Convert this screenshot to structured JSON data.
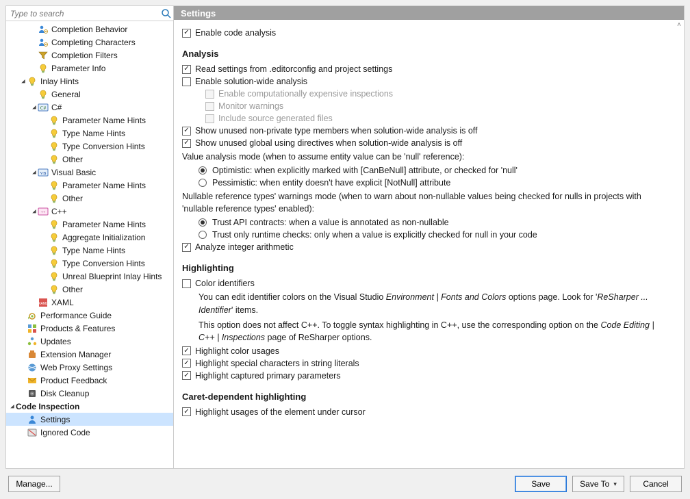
{
  "search": {
    "placeholder": "Type to search"
  },
  "header": {
    "title": "Settings"
  },
  "tree": [
    {
      "depth": 3,
      "icon": "person-gear",
      "label": "Completion Behavior"
    },
    {
      "depth": 3,
      "icon": "person-gear",
      "label": "Completing Characters"
    },
    {
      "depth": 3,
      "icon": "filter",
      "label": "Completion Filters"
    },
    {
      "depth": 3,
      "icon": "bulb",
      "label": "Parameter Info"
    },
    {
      "depth": 2,
      "icon": "bulb",
      "label": "Inlay Hints",
      "expanded": true
    },
    {
      "depth": 3,
      "icon": "bulb",
      "label": "General"
    },
    {
      "depth": 3,
      "icon": "csharp",
      "label": "C#",
      "expanded": true
    },
    {
      "depth": 4,
      "icon": "bulb",
      "label": "Parameter Name Hints"
    },
    {
      "depth": 4,
      "icon": "bulb",
      "label": "Type Name Hints"
    },
    {
      "depth": 4,
      "icon": "bulb",
      "label": "Type Conversion Hints"
    },
    {
      "depth": 4,
      "icon": "bulb",
      "label": "Other"
    },
    {
      "depth": 3,
      "icon": "vb",
      "label": "Visual Basic",
      "expanded": true
    },
    {
      "depth": 4,
      "icon": "bulb",
      "label": "Parameter Name Hints"
    },
    {
      "depth": 4,
      "icon": "bulb",
      "label": "Other"
    },
    {
      "depth": 3,
      "icon": "cpp",
      "label": "C++",
      "expanded": true
    },
    {
      "depth": 4,
      "icon": "bulb",
      "label": "Parameter Name Hints"
    },
    {
      "depth": 4,
      "icon": "bulb",
      "label": "Aggregate Initialization"
    },
    {
      "depth": 4,
      "icon": "bulb",
      "label": "Type Name Hints"
    },
    {
      "depth": 4,
      "icon": "bulb",
      "label": "Type Conversion Hints"
    },
    {
      "depth": 4,
      "icon": "bulb",
      "label": "Unreal Blueprint Inlay Hints"
    },
    {
      "depth": 4,
      "icon": "bulb",
      "label": "Other"
    },
    {
      "depth": 3,
      "icon": "xaml",
      "label": "XAML"
    },
    {
      "depth": 2,
      "icon": "snail",
      "label": "Performance Guide"
    },
    {
      "depth": 2,
      "icon": "grid",
      "label": "Products & Features"
    },
    {
      "depth": 2,
      "icon": "updates",
      "label": "Updates"
    },
    {
      "depth": 2,
      "icon": "ext",
      "label": "Extension Manager"
    },
    {
      "depth": 2,
      "icon": "globe",
      "label": "Web Proxy Settings"
    },
    {
      "depth": 2,
      "icon": "mail",
      "label": "Product Feedback"
    },
    {
      "depth": 2,
      "icon": "disk",
      "label": "Disk Cleanup"
    },
    {
      "depth": 1,
      "icon": "none",
      "label": "Code Inspection",
      "expanded": true,
      "bold": true
    },
    {
      "depth": 2,
      "icon": "person",
      "label": "Settings",
      "selected": true
    },
    {
      "depth": 2,
      "icon": "ignored",
      "label": "Ignored Code"
    }
  ],
  "settings": {
    "enable_code_analysis": "Enable code analysis",
    "analysis_title": "Analysis",
    "read_editorconfig": "Read settings from .editorconfig and project settings",
    "enable_swa": "Enable solution-wide analysis",
    "expensive": "Enable computationally expensive inspections",
    "monitor_warnings": "Monitor warnings",
    "include_sourcegen": "Include source generated files",
    "show_unused_members": "Show unused non-private type members when solution-wide analysis is off",
    "show_unused_usings": "Show unused global using directives when solution-wide analysis is off",
    "value_mode_label": "Value analysis mode (when to assume entity value can be 'null' reference):",
    "value_opt": "Optimistic: when explicitly marked with [CanBeNull] attribute, or checked for 'null'",
    "value_pess": "Pessimistic: when entity doesn't have explicit [NotNull] attribute",
    "nrt_label": "Nullable reference types' warnings mode (when to warn about non-nullable values being checked for nulls in projects with 'nullable reference types' enabled):",
    "nrt_trust": "Trust API contracts: when a value is annotated as non-nullable",
    "nrt_runtime": "Trust only runtime checks: only when a value is explicitly checked for null in your code",
    "analyze_int": "Analyze integer arithmetic",
    "highlighting_title": "Highlighting",
    "color_identifiers": "Color identifiers",
    "color_hint_1a": "You can edit identifier colors on the Visual Studio ",
    "color_hint_1b": "Environment | Fonts and Colors",
    "color_hint_1c": " options page. Look for '",
    "color_hint_1d": "ReSharper ... Identifier",
    "color_hint_1e": "' items.",
    "color_hint_2a": "This option does not affect C++. To toggle syntax highlighting in C++, use the corresponding option on the ",
    "color_hint_2b": "Code Editing | C++ | Inspections",
    "color_hint_2c": " page of ReSharper options.",
    "hl_color_usages": "Highlight color usages",
    "hl_special_chars": "Highlight special characters in string literals",
    "hl_primary_params": "Highlight captured primary parameters",
    "caret_title": "Caret-dependent highlighting",
    "hl_under_cursor": "Highlight usages of the element under cursor"
  },
  "footer": {
    "manage": "Manage...",
    "save": "Save",
    "save_to": "Save To",
    "cancel": "Cancel"
  }
}
